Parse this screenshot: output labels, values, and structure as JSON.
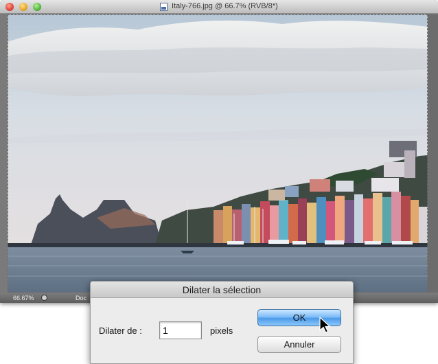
{
  "window": {
    "title": "Italy-766.jpg @ 66.7% (RVB/8*)"
  },
  "statusbar": {
    "zoom": "66.67%",
    "doc_label": "Doc"
  },
  "dialog": {
    "title": "Dilater la sélection",
    "label": "Dilater de :",
    "value": "1",
    "unit": "pixels",
    "ok_label": "OK",
    "cancel_label": "Annuler"
  },
  "colors": {
    "ok_button": "#6aaef2",
    "selection_highlight": "#fff37a"
  },
  "icons": {
    "document": "document-icon",
    "cursor": "arrow-cursor-icon"
  }
}
